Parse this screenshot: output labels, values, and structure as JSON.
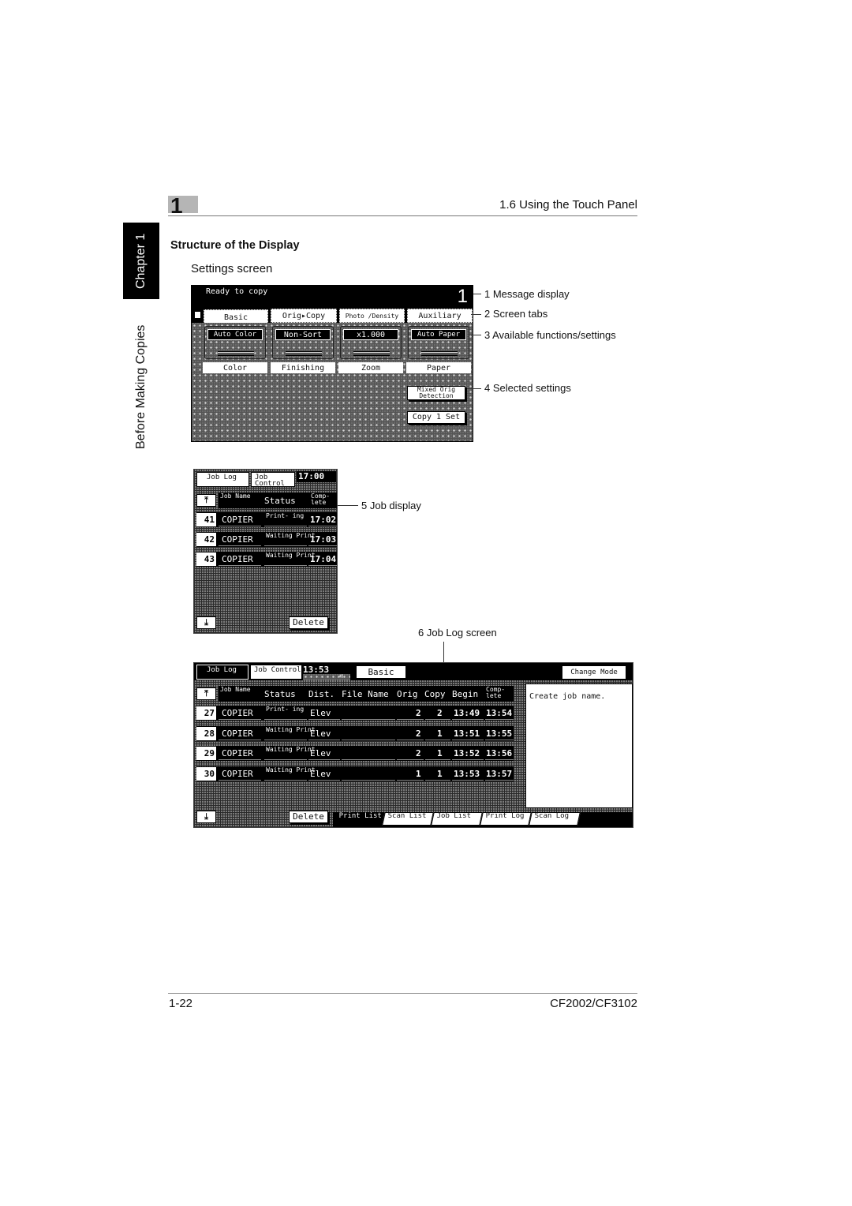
{
  "header": {
    "chapter_number": "1",
    "section_title": "1.6 Using the Touch Panel"
  },
  "side_tab": {
    "chapter_label": "Chapter 1",
    "section_label": "Before Making Copies"
  },
  "content": {
    "heading": "Structure of the Display",
    "subheading": "Settings screen"
  },
  "settings_screen": {
    "message": "Ready to copy",
    "copy_count": "1",
    "tabs": [
      "Basic",
      "Orig▸Copy",
      "Photo /Density",
      "Auxiliary"
    ],
    "active_tab": "Basic",
    "functions": [
      {
        "value": "Auto Color",
        "label": "Color"
      },
      {
        "value": "Non-Sort",
        "label": "Finishing"
      },
      {
        "value": "x1.000",
        "label": "Zoom"
      },
      {
        "value": "Auto Paper",
        "label": "Paper"
      }
    ],
    "selected_settings": [
      "Mixed Orig Detection",
      "Copy 1 Set"
    ]
  },
  "callouts": {
    "c1": "1 Message display",
    "c2": "2 Screen tabs",
    "c3": "3 Available functions/settings",
    "c4": "4 Selected settings",
    "c5": "5 Job display",
    "c6": "6 Job Log screen"
  },
  "job_display": {
    "tabs": [
      "Job Log",
      "Job Control"
    ],
    "time": "17:00",
    "columns": [
      "Job Name",
      "Status",
      "Comp- lete"
    ],
    "rows": [
      {
        "num": "41",
        "name": "COPIER",
        "status": "Print- ing",
        "complete": "17:02"
      },
      {
        "num": "42",
        "name": "COPIER",
        "status": "Waiting Print",
        "complete": "17:03"
      },
      {
        "num": "43",
        "name": "COPIER",
        "status": "Waiting Print",
        "complete": "17:04"
      }
    ],
    "delete_label": "Delete"
  },
  "job_log": {
    "tabs": [
      "Job Log",
      "Job Control"
    ],
    "time": "13:53",
    "basic_label": "Basic",
    "change_mode_label": "Change Mode",
    "columns": [
      "Job Name",
      "Status",
      "Dist.",
      "File Name",
      "Orig",
      "Copy",
      "Begin",
      "Comp- lete"
    ],
    "rows": [
      {
        "num": "27",
        "name": "COPIER",
        "status": "Print- ing",
        "dist": "Elev",
        "file": "",
        "orig": "2",
        "copy": "2",
        "begin": "13:49",
        "complete": "13:54"
      },
      {
        "num": "28",
        "name": "COPIER",
        "status": "Waiting Print",
        "dist": "Elev",
        "file": "",
        "orig": "2",
        "copy": "1",
        "begin": "13:51",
        "complete": "13:55"
      },
      {
        "num": "29",
        "name": "COPIER",
        "status": "Waiting Print",
        "dist": "Elev",
        "file": "",
        "orig": "2",
        "copy": "1",
        "begin": "13:52",
        "complete": "13:56"
      },
      {
        "num": "30",
        "name": "COPIER",
        "status": "Waiting Print",
        "dist": "Elev",
        "file": "",
        "orig": "1",
        "copy": "1",
        "begin": "13:53",
        "complete": "13:57"
      }
    ],
    "message": "Create job name.",
    "delete_label": "Delete",
    "bottom_tabs": [
      "Print List",
      "Scan List",
      "Job List",
      "Print Log",
      "Scan Log"
    ],
    "active_bottom_tab": "Print List"
  },
  "footer": {
    "page_number": "1-22",
    "model": "CF2002/CF3102"
  }
}
